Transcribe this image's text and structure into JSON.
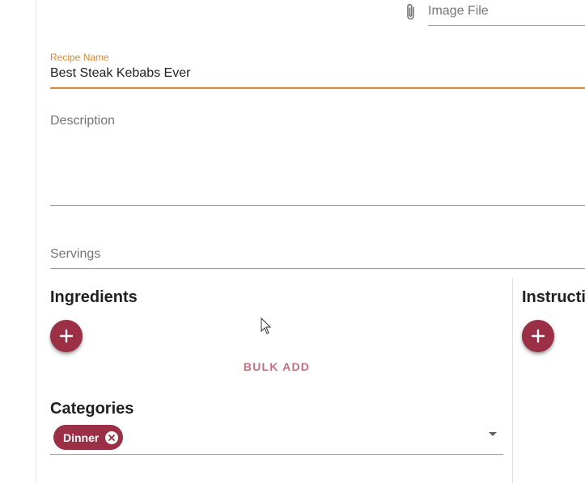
{
  "form": {
    "image_file": {
      "placeholder": "Image File",
      "icon": "paperclip-icon"
    },
    "recipe_name": {
      "label": "Recipe Name",
      "value": "Best Steak Kebabs Ever"
    },
    "description": {
      "placeholder": "Description"
    },
    "servings": {
      "placeholder": "Servings"
    }
  },
  "ingredients": {
    "title": "Ingredients",
    "bulk_add_label": "BULK ADD"
  },
  "instructions": {
    "title": "Instructions"
  },
  "categories": {
    "title": "Categories",
    "chips": [
      {
        "label": "Dinner"
      }
    ]
  },
  "colors": {
    "accent": "#e08a2e",
    "primary": "#9b2f45",
    "bulk_add_text": "#c4707f"
  }
}
